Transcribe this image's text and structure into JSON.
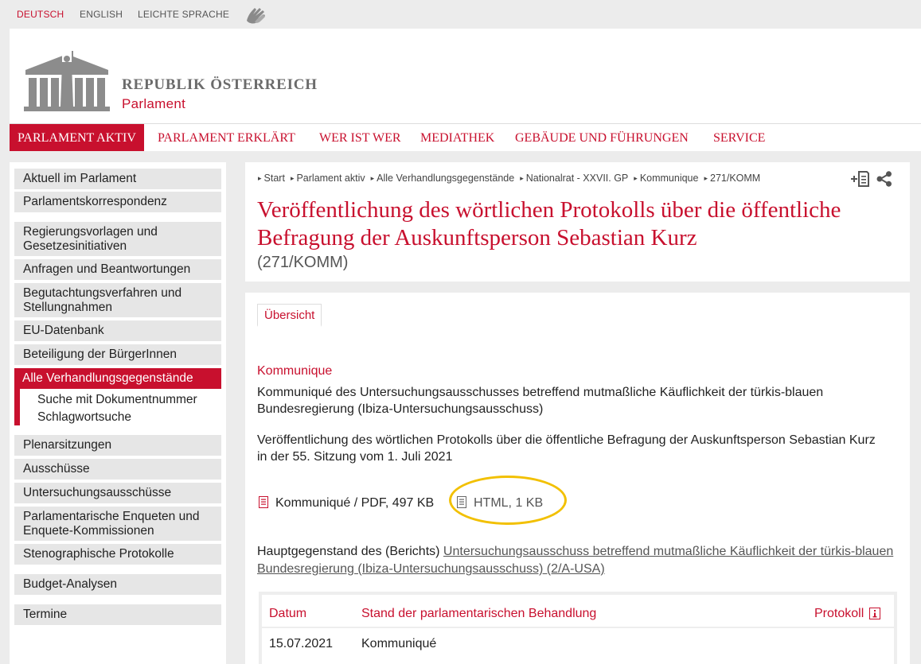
{
  "lang": {
    "items": [
      "DEUTSCH",
      "ENGLISH",
      "LEICHTE SPRACHE"
    ],
    "active_color": "#c8102e",
    "sign_icon": "sign-language-icon"
  },
  "header": {
    "brand_line1": "REPUBLIK ÖSTERREICH",
    "brand_line2": "Parlament",
    "logo_icon": "parliament-building-logo"
  },
  "nav": {
    "items": [
      "PARLAMENT AKTIV",
      "PARLAMENT ERKLÄRT",
      "WER IST WER",
      "MEDIATHEK",
      "GEBÄUDE UND FÜHRUNGEN",
      "SERVICE"
    ]
  },
  "sidebar": {
    "items": [
      "Aktuell im Parlament",
      "Parlamentskorrespondenz",
      "Regierungsvorlagen und Gesetzesinitiativen",
      "Anfragen und Beantwortungen",
      "Begutachtungsverfahren und Stellungnahmen",
      "EU-Datenbank",
      "Beteiligung der BürgerInnen",
      "Alle Verhandlungsgegenstände",
      "Plenarsitzungen",
      "Ausschüsse",
      "Untersuchungsausschüsse",
      "Parlamentarische Enqueten und Enquete-Kommissionen",
      "Stenographische Protokolle",
      "Budget-Analysen",
      "Termine"
    ],
    "subitems": [
      "Suche mit Dokumentnummer",
      "Schlagwortsuche"
    ]
  },
  "breadcrumb": [
    "Start",
    "Parlament aktiv",
    "Alle Verhandlungsgegenstände",
    "Nationalrat - XXVII. GP",
    "Kommunique",
    "271/KOMM"
  ],
  "page": {
    "title": "Veröffentlichung des wörtlichen Protokolls über die öffentliche Befragung der Auskunftsperson Sebastian Kurz",
    "subtitle": "(271/KOMM)"
  },
  "tabs": [
    "Übersicht"
  ],
  "content": {
    "section_heading": "Kommunique",
    "para1": "Kommuniqué des Untersuchungsausschusses betreffend mutmaßliche Käuflichkeit der türkis-blauen Bundesregierung (Ibiza-Untersuchungsausschuss)",
    "para2": "Veröffentlichung des wörtlichen Protokolls über die öffentliche Befragung der Auskunftsperson Sebastian Kurz in der 55. Sitzung vom 1. Juli 2021",
    "doc_pdf": "Kommuniqué / PDF, 497 KB",
    "doc_html": "HTML, 1 KB",
    "hg_label": "Hauptgegenstand des (Berichts)",
    "hg_link": "Untersuchungsausschuss betreffend mutmaßliche Käuflichkeit der türkis-blauen Bundesregierung (Ibiza-Untersuchungsausschuss) (2/A-USA)"
  },
  "table": {
    "headers": [
      "Datum",
      "Stand der parlamentarischen Behandlung",
      "Protokoll"
    ],
    "rows": [
      [
        "15.07.2021",
        "Kommuniqué"
      ]
    ]
  },
  "colors": {
    "brand_red": "#c8102e",
    "highlight": "#f2c000"
  }
}
